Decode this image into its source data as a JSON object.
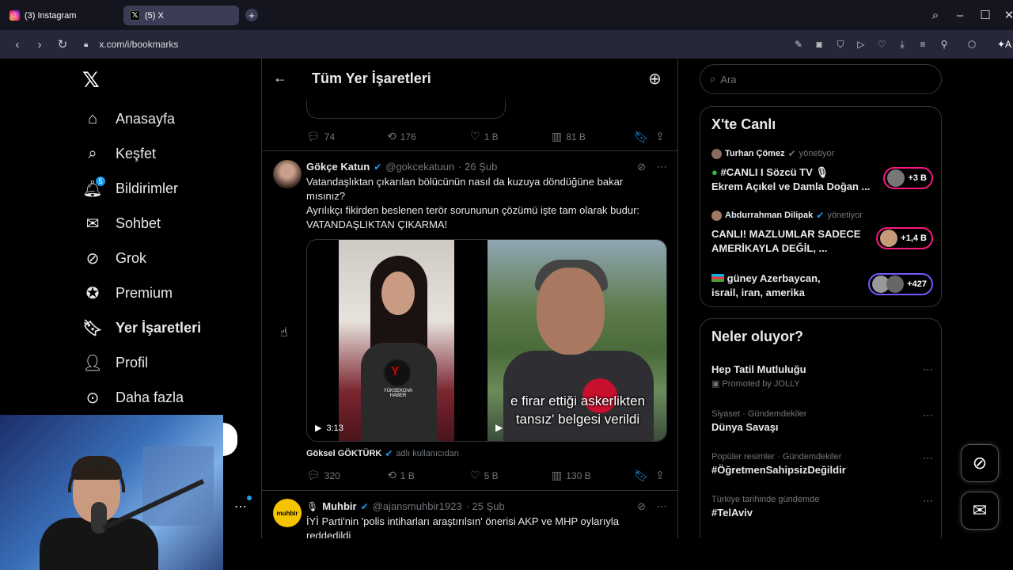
{
  "browser": {
    "tabs": [
      {
        "label": "(3) Instagram",
        "icon": "instagram-icon"
      },
      {
        "label": "(5) X",
        "icon": "x-icon"
      }
    ],
    "url": "x.com/i/bookmarks"
  },
  "nav": {
    "items": [
      {
        "label": "Anasayfa",
        "icon": "home-icon"
      },
      {
        "label": "Keşfet",
        "icon": "search-icon"
      },
      {
        "label": "Bildirimler",
        "icon": "bell-icon",
        "badge": "5"
      },
      {
        "label": "Sohbet",
        "icon": "mail-icon"
      },
      {
        "label": "Grok",
        "icon": "grok-icon"
      },
      {
        "label": "Premium",
        "icon": "premium-icon"
      },
      {
        "label": "Yer İşaretleri",
        "icon": "bookmark-icon"
      },
      {
        "label": "Profil",
        "icon": "profile-icon"
      },
      {
        "label": "Daha fazla",
        "icon": "more-icon"
      }
    ]
  },
  "main": {
    "title": "Tüm Yer İşaretleri",
    "prev_tweet_actions": {
      "replies": "74",
      "reposts": "176",
      "likes": "1 B",
      "views": "81 B"
    },
    "tweet1": {
      "name": "Gökçe Katun",
      "handle": "@gokcekatuun",
      "date": "· 26 Şub",
      "line1": "Vatandaşlıktan çıkarılan bölücünün nasıl da kuzuya döndüğüne bakar",
      "line2": "mısınız?",
      "line3": "Ayrılıkçı fikirden beslenen terör sorununun çözümü işte tam olarak budur:",
      "line4": "VATANDAŞLIKTAN ÇIKARMA!",
      "video_time": "3:13",
      "subtitle1": "e firar ettiği askerlikten",
      "subtitle2": "tansız' belgesi verildi",
      "mic_label": "YÜKSEKOVA HABER",
      "credit_name": "Göksel GÖKTÜRK",
      "credit_suffix": "adlı kullanıcıdan",
      "replies": "320",
      "reposts": "1 B",
      "likes": "5 B",
      "views": "130 B"
    },
    "tweet2": {
      "name": "Muhbir",
      "handle": "@ajansmuhbir1923",
      "date": "· 25 Şub",
      "avatar_text": "muhbir",
      "line1": "İYİ Parti'nin 'polis intiharları araştırılsın' önerisi AKP ve MHP oylarıyla",
      "line2": "reddedildi"
    }
  },
  "sidebar": {
    "search_placeholder": "Ara",
    "live_title": "X'te Canlı",
    "live": [
      {
        "host": "Turhan Çömez",
        "role": "yönetiyor",
        "title1": "#CANLI I Sözcü TV",
        "title2": "Ekrem Açıkel ve Damla Doğan ...",
        "count": "+3 B"
      },
      {
        "host": "Abdurrahman Dilipak",
        "role": "yönetiyor",
        "title1": "CANLI! MAZLUMLAR SADECE",
        "title2": "AMERİKAYLA DEĞİL, ...",
        "count": "+1,4 B"
      },
      {
        "host": "",
        "role": "",
        "title1": "güney Azerbaycan,",
        "title2": "israil, iran, amerika",
        "count": "+427"
      }
    ],
    "trends_title": "Neler oluyor?",
    "trends": [
      {
        "category": "",
        "name": "Hep Tatil Mutluluğu",
        "promo": "Promoted by JOLLY"
      },
      {
        "category": "Siyaset · Gündemdekiler",
        "name": "Dünya Savaşı",
        "promo": ""
      },
      {
        "category": "Popüler resimler · Gündemdekiler",
        "name": "#ÖğretmenSahipsizDeğildir",
        "promo": ""
      },
      {
        "category": "Türkiye tarihinde gündemde",
        "name": "#TelAviv",
        "promo": ""
      }
    ]
  },
  "colors": {
    "accent": "#1d9bf0",
    "live_ring": "#f91880",
    "background": "#000000"
  }
}
